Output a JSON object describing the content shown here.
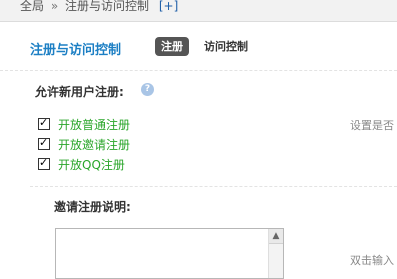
{
  "breadcrumb": {
    "root": "全局",
    "separator": "»",
    "current": "注册与访问控制",
    "plus": "[+]"
  },
  "header": {
    "title": "注册与访问控制",
    "tabs": [
      {
        "label": "注册",
        "active": true
      },
      {
        "label": "访问控制",
        "active": false
      }
    ]
  },
  "registration": {
    "label": "允许新用户注册:",
    "help_icon": "question-icon",
    "options": [
      {
        "label": "开放普通注册",
        "checked": true
      },
      {
        "label": "开放邀请注册",
        "checked": true
      },
      {
        "label": "开放QQ注册",
        "checked": true
      }
    ],
    "hint": "设置是否"
  },
  "invite": {
    "label": "邀请注册说明:",
    "textarea_value": "",
    "hint": "双击输入"
  },
  "colors": {
    "accent": "#1c7fc4",
    "option_green": "#2aa62a",
    "tab_active_bg": "#555555"
  }
}
